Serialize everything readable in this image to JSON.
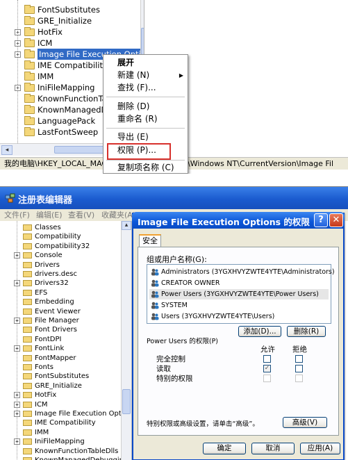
{
  "top": {
    "tree_items": [
      {
        "label": "FontSubstitutes",
        "expandable": false
      },
      {
        "label": "GRE_Initialize",
        "expandable": false
      },
      {
        "label": "HotFix",
        "expandable": true
      },
      {
        "label": "ICM",
        "expandable": true
      },
      {
        "label": "Image File Execution Opti",
        "expandable": true,
        "selected": true
      },
      {
        "label": "IME Compatibilit",
        "expandable": false
      },
      {
        "label": "IMM",
        "expandable": false
      },
      {
        "label": "IniFileMapping",
        "expandable": true
      },
      {
        "label": "KnownFunctionTab",
        "expandable": false
      },
      {
        "label": "KnownManagedDebu",
        "expandable": false
      },
      {
        "label": "LanguagePack",
        "expandable": false
      },
      {
        "label": "LastFontSweep",
        "expandable": false
      }
    ],
    "status_left": "我的电脑\\HKEY_LOCAL_MACH",
    "status_right": "ft\\Windows NT\\CurrentVersion\\Image Fil",
    "context_menu": {
      "expand": "展开",
      "new": "新建",
      "new_key": "(N)",
      "find": "查找",
      "find_key": "(F)...",
      "delete": "删除",
      "delete_key": "(D)",
      "rename": "重命名",
      "rename_key": "(R)",
      "export": "导出",
      "export_key": "(E)",
      "permissions": "权限",
      "permissions_key": "(P)...",
      "copy_name": "复制项名称",
      "copy_name_key": "(C)"
    },
    "highlight_color": "#d7302c"
  },
  "bottom": {
    "window_title": "注册表编辑器",
    "menu": [
      "文件(F)",
      "编辑(E)",
      "查看(V)",
      "收藏夹(A)"
    ],
    "tree_items": [
      {
        "label": "Classes",
        "expandable": false
      },
      {
        "label": "Compatibility",
        "expandable": false
      },
      {
        "label": "Compatibility32",
        "expandable": false
      },
      {
        "label": "Console",
        "expandable": true
      },
      {
        "label": "Drivers",
        "expandable": false
      },
      {
        "label": "drivers.desc",
        "expandable": false
      },
      {
        "label": "Drivers32",
        "expandable": true
      },
      {
        "label": "EFS",
        "expandable": false
      },
      {
        "label": "Embedding",
        "expandable": false
      },
      {
        "label": "Event Viewer",
        "expandable": false
      },
      {
        "label": "File Manager",
        "expandable": true
      },
      {
        "label": "Font Drivers",
        "expandable": false
      },
      {
        "label": "FontDPI",
        "expandable": false
      },
      {
        "label": "FontLink",
        "expandable": true
      },
      {
        "label": "FontMapper",
        "expandable": false
      },
      {
        "label": "Fonts",
        "expandable": false
      },
      {
        "label": "FontSubstitutes",
        "expandable": false
      },
      {
        "label": "GRE_Initialize",
        "expandable": false
      },
      {
        "label": "HotFix",
        "expandable": true
      },
      {
        "label": "ICM",
        "expandable": true
      },
      {
        "label": "Image File Execution Opti",
        "expandable": true
      },
      {
        "label": "IME Compatibility",
        "expandable": false
      },
      {
        "label": "IMM",
        "expandable": false
      },
      {
        "label": "IniFileMapping",
        "expandable": true
      },
      {
        "label": "KnownFunctionTableDlls",
        "expandable": false
      },
      {
        "label": "KnownManagedDebuggingDlls",
        "expandable": false
      }
    ],
    "dialog": {
      "title": "Image File Execution Options 的权限",
      "help": "?",
      "close": "✕",
      "tab": "安全",
      "users_label": "组或用户名称(G):",
      "users": [
        {
          "name": "Administrators (3YGXHVYZWTE4YTE\\Administrators)",
          "selected": false
        },
        {
          "name": "CREATOR OWNER",
          "selected": false
        },
        {
          "name": "Power Users (3YGXHVYZWTE4YTE\\Power Users)",
          "selected": true
        },
        {
          "name": "SYSTEM",
          "selected": false
        },
        {
          "name": "Users (3YGXHVYZWTE4YTE\\Users)",
          "selected": false
        }
      ],
      "add_button": "添加(D)...",
      "remove_button": "删除(R)",
      "perm_label": "Power Users 的权限(P)",
      "col_allow": "允许",
      "col_deny": "拒绝",
      "permissions": [
        {
          "name": "完全控制",
          "allow": false,
          "deny": false,
          "disabled": false
        },
        {
          "name": "读取",
          "allow": true,
          "deny": false,
          "disabled": false
        },
        {
          "name": "特别的权限",
          "allow": false,
          "deny": false,
          "disabled": true
        }
      ],
      "advanced_text": "特别权限或高级设置，请单击“高级”。",
      "advanced_button": "高级(V)",
      "ok_button": "确定",
      "cancel_button": "取消",
      "apply_button": "应用(A)"
    }
  }
}
